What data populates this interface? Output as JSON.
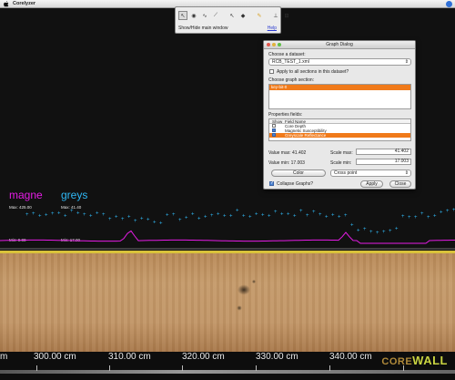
{
  "menubar": {
    "app_name": "Corelyzer"
  },
  "palette": {
    "status_text": "Show/Hide main window",
    "help_label": "Help"
  },
  "dialog": {
    "title": "Graph Dialog",
    "choose_dataset_label": "Choose a dataset:",
    "dataset_value": "RCB_TEST_1.xml",
    "apply_all_label": "Apply to all sections in this dataset?",
    "choose_section_label": "Choose graph section:",
    "sections": [
      "key-bit-0"
    ],
    "properties_label": "Properties fields:",
    "col_show": "Show",
    "col_field": "Field Name",
    "fields": [
      {
        "name": "Core Depth",
        "show": false,
        "selected": false
      },
      {
        "name": "Magnetic Susceptibility",
        "show": true,
        "selected": false
      },
      {
        "name": "Greyscale Reflectance",
        "show": true,
        "selected": true
      }
    ],
    "value_max_label": "Value max: 41.402",
    "value_min_label": "Value min: 17.003",
    "scale_max_label": "Scale max:",
    "scale_max_value": "41.402",
    "scale_min_label": "Scale min:",
    "scale_min_value": "17.003",
    "color_button": "Color",
    "point_style": "Cross point",
    "collapse_label": "Collapse Graphs?",
    "apply_button": "Apply",
    "close_button": "Close"
  },
  "graph": {
    "magne_name": "magne",
    "greys_name": "greys",
    "magne_max": "Max: 425.00",
    "greys_max": "Max: 41.40",
    "magne_min": "Min: 9.00",
    "greys_min": "Min: 17.00",
    "colors": {
      "magne": "#e61ce6",
      "greys": "#2fb8f5",
      "baseline": "#f2e63a"
    }
  },
  "ruler": {
    "labels": [
      "m",
      "300.00 cm",
      "310.00 cm",
      "320.00 cm",
      "330.00 cm",
      "340.00 cm"
    ],
    "logo_core": "CORE",
    "logo_wall": "WALL"
  }
}
